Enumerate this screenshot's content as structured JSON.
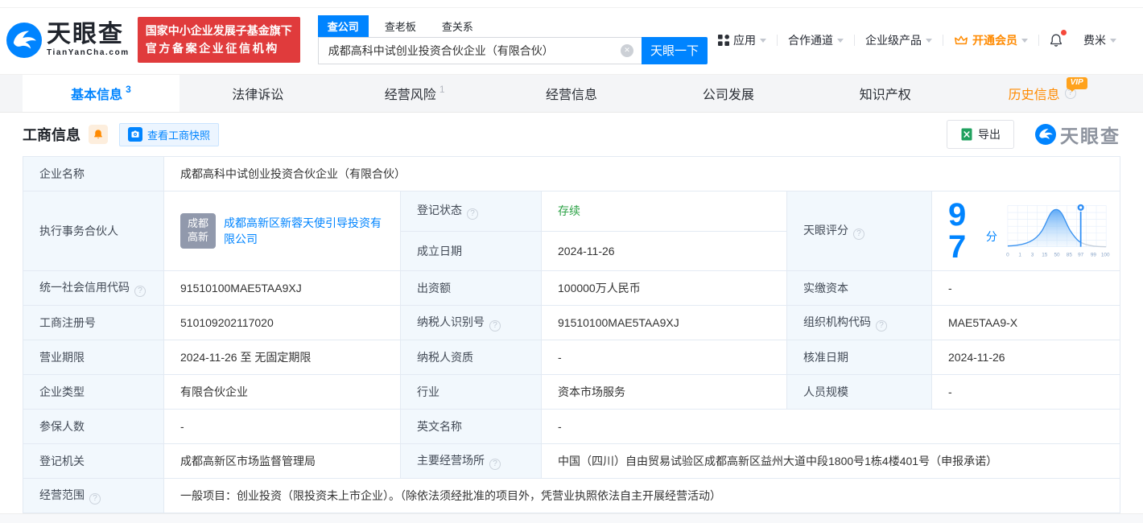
{
  "brand": {
    "name": "天眼查",
    "domain": "TianYanCha.com",
    "badge_line1": "国家中小企业发展子基金旗下",
    "badge_line2": "官方备案企业征信机构"
  },
  "search": {
    "tabs": [
      {
        "label": "查公司",
        "active": true
      },
      {
        "label": "查老板",
        "active": false
      },
      {
        "label": "查关系",
        "active": false
      }
    ],
    "value": "成都高科中试创业投资合伙企业（有限合伙）",
    "button": "天眼一下"
  },
  "top_menu": {
    "apps": "应用",
    "channel": "合作通道",
    "enterprise": "企业级产品",
    "vip": "开通会员",
    "user": "费米"
  },
  "nav_tabs": [
    {
      "label": "基本信息",
      "count": "3",
      "active": true
    },
    {
      "label": "法律诉讼"
    },
    {
      "label": "经营风险",
      "count": "1"
    },
    {
      "label": "经营信息"
    },
    {
      "label": "公司发展"
    },
    {
      "label": "知识产权"
    },
    {
      "label": "历史信息",
      "vip_badge": "VIP"
    }
  ],
  "section": {
    "title": "工商信息",
    "snapshot_button": "查看工商快照",
    "export_button": "导出",
    "watermark": "天眼查"
  },
  "info": {
    "company_name": {
      "label": "企业名称",
      "value": "成都高科中试创业投资合伙企业（有限合伙）"
    },
    "partner": {
      "label": "执行事务合伙人",
      "avatar_line1": "成都",
      "avatar_line2": "高新",
      "company": "成都高新区新蓉天使引导投资有限公司"
    },
    "reg_status": {
      "label": "登记状态",
      "value": "存续"
    },
    "est_date": {
      "label": "成立日期",
      "value": "2024-11-26"
    },
    "score": {
      "label": "天眼评分",
      "value": "97",
      "unit": "分"
    },
    "credit_code": {
      "label": "统一社会信用代码",
      "value": "91510100MAE5TAA9XJ"
    },
    "capital": {
      "label": "出资额",
      "value": "100000万人民币"
    },
    "paid_capital": {
      "label": "实缴资本",
      "value": "-"
    },
    "reg_number": {
      "label": "工商注册号",
      "value": "510109202117020"
    },
    "taxpayer_id": {
      "label": "纳税人识别号",
      "value": "91510100MAE5TAA9XJ"
    },
    "org_code": {
      "label": "组织机构代码",
      "value": "MAE5TAA9-X"
    },
    "business_term": {
      "label": "营业期限",
      "value": "2024-11-26 至 无固定期限"
    },
    "taxpayer_quality": {
      "label": "纳税人资质",
      "value": "-"
    },
    "approval_date": {
      "label": "核准日期",
      "value": "2024-11-26"
    },
    "company_type": {
      "label": "企业类型",
      "value": "有限合伙企业"
    },
    "industry": {
      "label": "行业",
      "value": "资本市场服务"
    },
    "staff_size": {
      "label": "人员规模",
      "value": "-"
    },
    "insured_count": {
      "label": "参保人数",
      "value": "-"
    },
    "english_name": {
      "label": "英文名称",
      "value": "-"
    },
    "reg_authority": {
      "label": "登记机关",
      "value": "成都高新区市场监督管理局"
    },
    "business_site": {
      "label": "主要经营场所",
      "value": "中国（四川）自由贸易试验区成都高新区益州大道中段1800号1栋4楼401号（申报承诺）"
    },
    "business_scope": {
      "label": "经营范围",
      "value": "一般项目：创业投资（限投资未上市企业）。（除依法须经批准的项目外，凭营业执照依法自主开展经营活动）"
    }
  },
  "score_chart": {
    "type": "area",
    "score": 97,
    "marker_tick": "97",
    "ticks": [
      "0",
      "1",
      "3",
      "15",
      "50",
      "85",
      "97",
      "99",
      "100"
    ],
    "curve": "bell-distribution",
    "color": "#2f8ef5"
  },
  "colors": {
    "accent": "#0084ff",
    "orange": "#ff8a00",
    "green": "#2ba245",
    "badge_red": "#e03b3c"
  }
}
